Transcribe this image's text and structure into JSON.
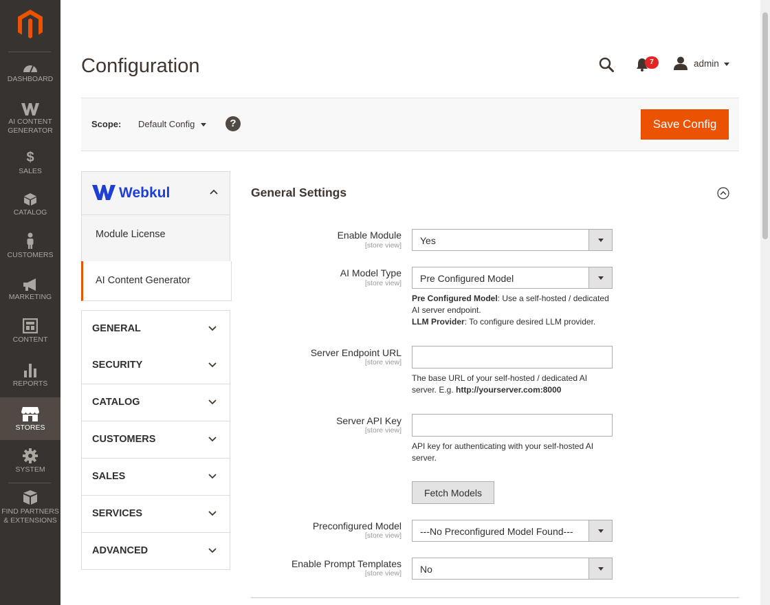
{
  "nav": {
    "items": [
      {
        "label": "DASHBOARD",
        "icon": "dashboard-icon"
      },
      {
        "label": "AI CONTENT GENERATOR",
        "icon": "webkul-icon"
      },
      {
        "label": "SALES",
        "icon": "dollar-icon"
      },
      {
        "label": "CATALOG",
        "icon": "cube-icon"
      },
      {
        "label": "CUSTOMERS",
        "icon": "person-icon"
      },
      {
        "label": "MARKETING",
        "icon": "megaphone-icon"
      },
      {
        "label": "CONTENT",
        "icon": "layout-icon"
      },
      {
        "label": "REPORTS",
        "icon": "bar-chart-icon"
      },
      {
        "label": "STORES",
        "icon": "store-icon"
      },
      {
        "label": "SYSTEM",
        "icon": "gear-icon"
      },
      {
        "label": "FIND PARTNERS & EXTENSIONS",
        "icon": "boxes-icon"
      }
    ],
    "active": "STORES"
  },
  "header": {
    "title": "Configuration",
    "notification_count": "7",
    "user": "admin"
  },
  "scope": {
    "label": "Scope:",
    "value": "Default Config",
    "save_label": "Save Config"
  },
  "tabs": {
    "brand": "Webkul",
    "sub_items": [
      "Module License",
      "AI Content Generator"
    ],
    "active_sub": "AI Content Generator",
    "sections": [
      "GENERAL",
      "SECURITY",
      "CATALOG",
      "CUSTOMERS",
      "SALES",
      "SERVICES",
      "ADVANCED"
    ]
  },
  "settings": {
    "title": "General Settings",
    "scope_hint": "[store view]",
    "enable_module": {
      "label": "Enable Module",
      "value": "Yes"
    },
    "model_type": {
      "label": "AI Model Type",
      "value": "Pre Configured Model",
      "note_a_bold": "Pre Configured Model",
      "note_a": ": Use a self-hosted / dedicated AI server endpoint.",
      "note_b_bold": "LLM Provider",
      "note_b": ": To configure desired LLM provider."
    },
    "endpoint": {
      "label": "Server Endpoint URL",
      "value": "",
      "note": "The base URL of your self-hosted / dedicated AI server. E.g. ",
      "note_bold": "http://yourserver.com:8000"
    },
    "api_key": {
      "label": "Server API Key",
      "value": "",
      "note": "API key for authenticating with your self-hosted AI server."
    },
    "fetch_label": "Fetch Models",
    "preconfigured": {
      "label": "Preconfigured Model",
      "value": "---No Preconfigured Model Found---"
    },
    "prompt_templates": {
      "label": "Enable Prompt Templates",
      "value": "No"
    }
  }
}
